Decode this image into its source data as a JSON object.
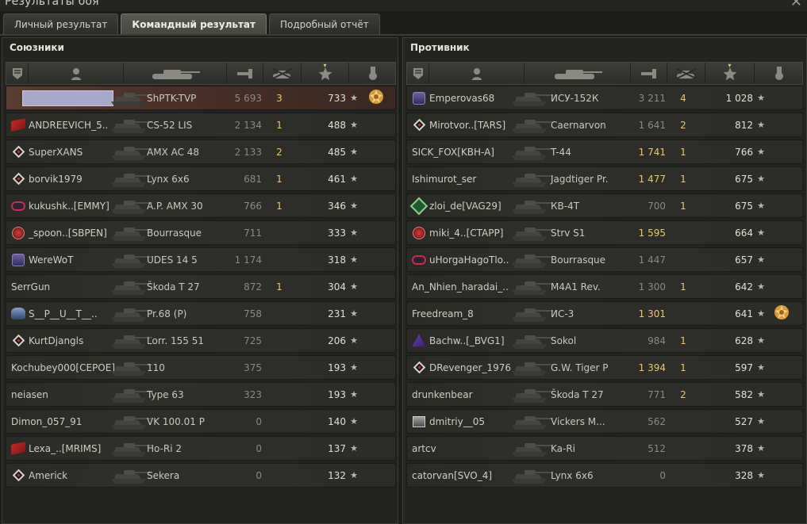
{
  "window": {
    "title": "Результаты боя",
    "close_symbol": "✕"
  },
  "tabs": [
    {
      "label": "Личный результат",
      "active": false
    },
    {
      "label": "Командный результат",
      "active": true
    },
    {
      "label": "Подробный отчёт",
      "active": false
    }
  ],
  "columns": {
    "icons": [
      "rank-icon",
      "player-icon",
      "vehicle-icon",
      "damage-icon",
      "frags-icon",
      "xp-star-icon",
      "medal-icon"
    ],
    "sort_indicator": "▾"
  },
  "allies": {
    "title": "Союзники",
    "rows": [
      {
        "player": "",
        "self": true,
        "icon": "self",
        "vehicle": "ShPTK-TVP",
        "damage": "5 693",
        "damage_hi": false,
        "frags": "3",
        "xp": "733",
        "medal": "gear-medal"
      },
      {
        "player": "ANDREEVICH_5..",
        "icon": "flag-red",
        "vehicle": "CS-52 LIS",
        "damage": "2 134",
        "damage_hi": false,
        "frags": "1",
        "xp": "488",
        "medal": ""
      },
      {
        "player": "SuperXANS",
        "icon": "diamond",
        "vehicle": "AMX AC 48",
        "damage": "2 133",
        "damage_hi": false,
        "frags": "2",
        "xp": "485",
        "medal": ""
      },
      {
        "player": "borvik1979",
        "icon": "diamond",
        "vehicle": "Lynx 6x6",
        "damage": "681",
        "damage_hi": false,
        "frags": "1",
        "xp": "461",
        "medal": ""
      },
      {
        "player": "kukushk..[EMMY]",
        "icon": "tank",
        "vehicle": "A.P. AMX 30",
        "damage": "766",
        "damage_hi": false,
        "frags": "1",
        "xp": "346",
        "medal": ""
      },
      {
        "player": "_spoon..[SBPEN]",
        "icon": "round",
        "vehicle": "Bourrasque",
        "damage": "711",
        "damage_hi": false,
        "frags": "",
        "xp": "333",
        "medal": ""
      },
      {
        "player": "WereWoT",
        "icon": "shield",
        "vehicle": "UDES 14 5",
        "damage": "1 174",
        "damage_hi": false,
        "frags": "",
        "xp": "318",
        "medal": ""
      },
      {
        "player": "SerrGun",
        "icon": "",
        "vehicle": "Škoda T 27",
        "damage": "872",
        "damage_hi": false,
        "frags": "1",
        "xp": "304",
        "medal": ""
      },
      {
        "player": "S__P__U__T__..",
        "icon": "wolf",
        "vehicle": "Pr.68 (P)",
        "damage": "758",
        "damage_hi": false,
        "frags": "",
        "xp": "231",
        "medal": ""
      },
      {
        "player": "KurtDjangls",
        "icon": "diamond",
        "vehicle": "Lorr. 155 51",
        "damage": "725",
        "damage_hi": false,
        "frags": "",
        "xp": "206",
        "medal": ""
      },
      {
        "player": "Kochubey000[CEPOE]",
        "icon": "",
        "vehicle": "110",
        "damage": "375",
        "damage_hi": false,
        "frags": "",
        "xp": "193",
        "medal": ""
      },
      {
        "player": "neiasen",
        "icon": "",
        "vehicle": "Type 63",
        "damage": "323",
        "damage_hi": false,
        "frags": "",
        "xp": "193",
        "medal": ""
      },
      {
        "player": "Dimon_057_91",
        "icon": "",
        "vehicle": "VK 100.01 P",
        "damage": "0",
        "damage_hi": false,
        "frags": "",
        "xp": "140",
        "medal": ""
      },
      {
        "player": "Lexa_..[MRIMS]",
        "icon": "flag-red",
        "vehicle": "Ho-Ri 2",
        "damage": "0",
        "damage_hi": false,
        "frags": "",
        "xp": "137",
        "medal": ""
      },
      {
        "player": "Americk",
        "icon": "diamond",
        "vehicle": "Sekera",
        "damage": "0",
        "damage_hi": false,
        "frags": "",
        "xp": "132",
        "medal": ""
      }
    ]
  },
  "enemies": {
    "title": "Противник",
    "rows": [
      {
        "player": "Emperovas68",
        "icon": "shield",
        "vehicle": "ИСУ-152К",
        "damage": "3 211",
        "damage_hi": false,
        "frags": "4",
        "xp": "1 028",
        "medal": ""
      },
      {
        "player": "Mirotvor..[TARS]",
        "icon": "diamond",
        "vehicle": "Caernarvon",
        "damage": "1 641",
        "damage_hi": false,
        "frags": "2",
        "xp": "812",
        "medal": ""
      },
      {
        "player": "SICK_FOX[KBH-A]",
        "icon": "",
        "vehicle": "T-44",
        "damage": "1 741",
        "damage_hi": true,
        "frags": "1",
        "xp": "766",
        "medal": ""
      },
      {
        "player": "Ishimurot_ser",
        "icon": "",
        "vehicle": "Jagdtiger Pr.",
        "damage": "1 477",
        "damage_hi": true,
        "frags": "1",
        "xp": "675",
        "medal": ""
      },
      {
        "player": "zloi_de[VAG29]",
        "icon": "green",
        "vehicle": "КВ-4Т",
        "damage": "700",
        "damage_hi": false,
        "frags": "1",
        "xp": "675",
        "medal": ""
      },
      {
        "player": "miki_4..[CTAPP]",
        "icon": "round",
        "vehicle": "Strv S1",
        "damage": "1 595",
        "damage_hi": true,
        "frags": "",
        "xp": "664",
        "medal": ""
      },
      {
        "player": "uHorgaHagoTlo..",
        "icon": "tank",
        "vehicle": "Bourrasque",
        "damage": "1 447",
        "damage_hi": false,
        "frags": "",
        "xp": "657",
        "medal": ""
      },
      {
        "player": "An_Nhien_haradai_..",
        "icon": "",
        "vehicle": "M4A1 Rev.",
        "damage": "1 300",
        "damage_hi": false,
        "frags": "1",
        "xp": "642",
        "medal": ""
      },
      {
        "player": "Freedream_8",
        "icon": "",
        "vehicle": "ИС-3",
        "damage": "1 301",
        "damage_hi": true,
        "frags": "",
        "xp": "641",
        "medal": "gear-medal"
      },
      {
        "player": "Bachw..[_BVG1]",
        "icon": "purple",
        "vehicle": "Sokol",
        "damage": "984",
        "damage_hi": false,
        "frags": "1",
        "xp": "628",
        "medal": ""
      },
      {
        "player": "DRevenger_1976",
        "icon": "diamond",
        "vehicle": "G.W. Tiger P",
        "damage": "1 394",
        "damage_hi": true,
        "frags": "1",
        "xp": "597",
        "medal": ""
      },
      {
        "player": "drunkenbear",
        "icon": "",
        "vehicle": "Škoda T 27",
        "damage": "771",
        "damage_hi": false,
        "frags": "2",
        "xp": "582",
        "medal": ""
      },
      {
        "player": "dmitriy__05",
        "icon": "box",
        "vehicle": "Vickers M...",
        "damage": "562",
        "damage_hi": false,
        "frags": "",
        "xp": "527",
        "medal": ""
      },
      {
        "player": "artcv",
        "icon": "",
        "vehicle": "Ka-Ri",
        "damage": "512",
        "damage_hi": false,
        "frags": "",
        "xp": "378",
        "medal": ""
      },
      {
        "player": "catorvan[SVO_4]",
        "icon": "",
        "vehicle": "Lynx 6x6",
        "damage": "0",
        "damage_hi": false,
        "frags": "",
        "xp": "328",
        "medal": ""
      }
    ]
  },
  "star_glyph": "★",
  "colors": {
    "accent_gold": "#e8c86a",
    "self_row": "#5a3c30",
    "panel": "#232321"
  }
}
